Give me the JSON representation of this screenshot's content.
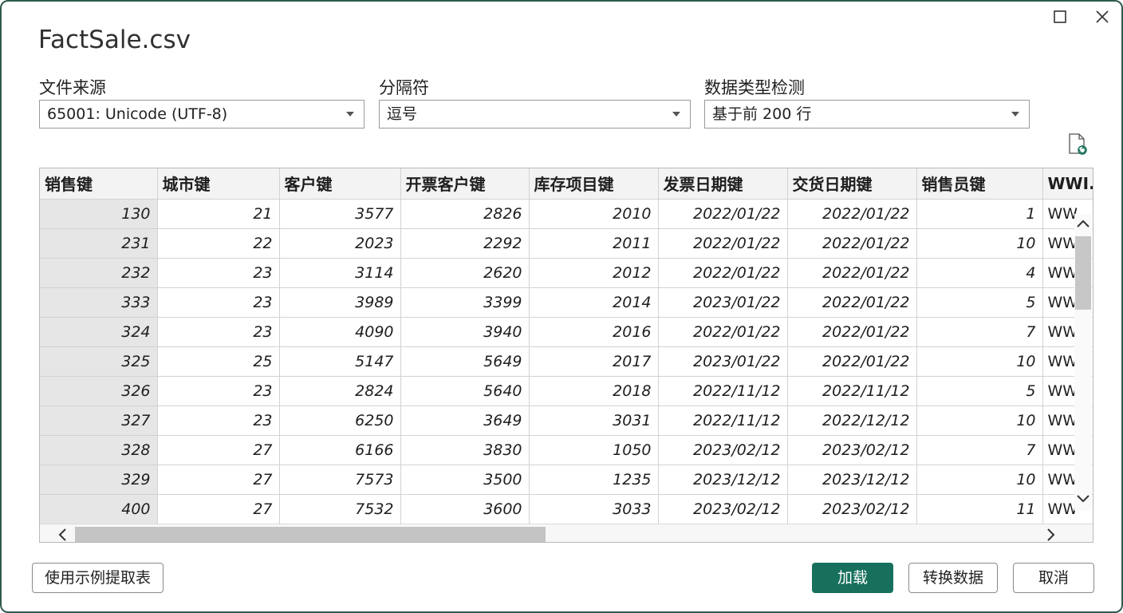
{
  "window": {
    "title": "FactSale.csv",
    "controls": [
      {
        "icon": "maximize-icon"
      },
      {
        "icon": "close-icon"
      }
    ]
  },
  "options": {
    "file_origin": {
      "label": "文件来源",
      "value": "65001: Unicode (UTF-8)"
    },
    "delimiter": {
      "label": "分隔符",
      "value": "逗号"
    },
    "type_detection": {
      "label": "数据类型检测",
      "value": "基于前 200 行"
    }
  },
  "refresh_icon": "refresh-document-icon",
  "table": {
    "columns": [
      "销售键",
      "城市键",
      "客户键",
      "开票客户键",
      "库存项目键",
      "发票日期键",
      "交货日期键",
      "销售员键",
      "WWI..."
    ],
    "rows": [
      [
        "130",
        "21",
        "3577",
        "2826",
        "2010",
        "2022/01/22",
        "2022/01/22",
        "1",
        "WW"
      ],
      [
        "231",
        "22",
        "2023",
        "2292",
        "2011",
        "2022/01/22",
        "2022/01/22",
        "10",
        "WW"
      ],
      [
        "232",
        "23",
        "3114",
        "2620",
        "2012",
        "2022/01/22",
        "2022/01/22",
        "4",
        "WW"
      ],
      [
        "333",
        "23",
        "3989",
        "3399",
        "2014",
        "2023/01/22",
        "2022/01/22",
        "5",
        "WW"
      ],
      [
        "324",
        "23",
        "4090",
        "3940",
        "2016",
        "2022/01/22",
        "2022/01/22",
        "7",
        "WW"
      ],
      [
        "325",
        "25",
        "5147",
        "5649",
        "2017",
        "2023/01/22",
        "2022/01/22",
        "10",
        "WW"
      ],
      [
        "326",
        "23",
        "2824",
        "5640",
        "2018",
        "2022/11/12",
        "2022/11/12",
        "5",
        "WW"
      ],
      [
        "327",
        "23",
        "6250",
        "3649",
        "3031",
        "2022/11/12",
        "2022/12/12",
        "10",
        "WW"
      ],
      [
        "328",
        "27",
        "6166",
        "3830",
        "1050",
        "2023/02/12",
        "2023/02/12",
        "7",
        "WW"
      ],
      [
        "329",
        "27",
        "7573",
        "3500",
        "1235",
        "2023/12/12",
        "2023/12/12",
        "10",
        "WW"
      ],
      [
        "400",
        "27",
        "7532",
        "3600",
        "3033",
        "2023/02/12",
        "2023/02/12",
        "11",
        "WW"
      ]
    ]
  },
  "buttons": {
    "extract": "使用示例提取表",
    "load": "加载",
    "transform": "转换数据",
    "cancel": "取消"
  },
  "colors": {
    "primary": "#17705c",
    "frame": "#2f5b4f"
  }
}
